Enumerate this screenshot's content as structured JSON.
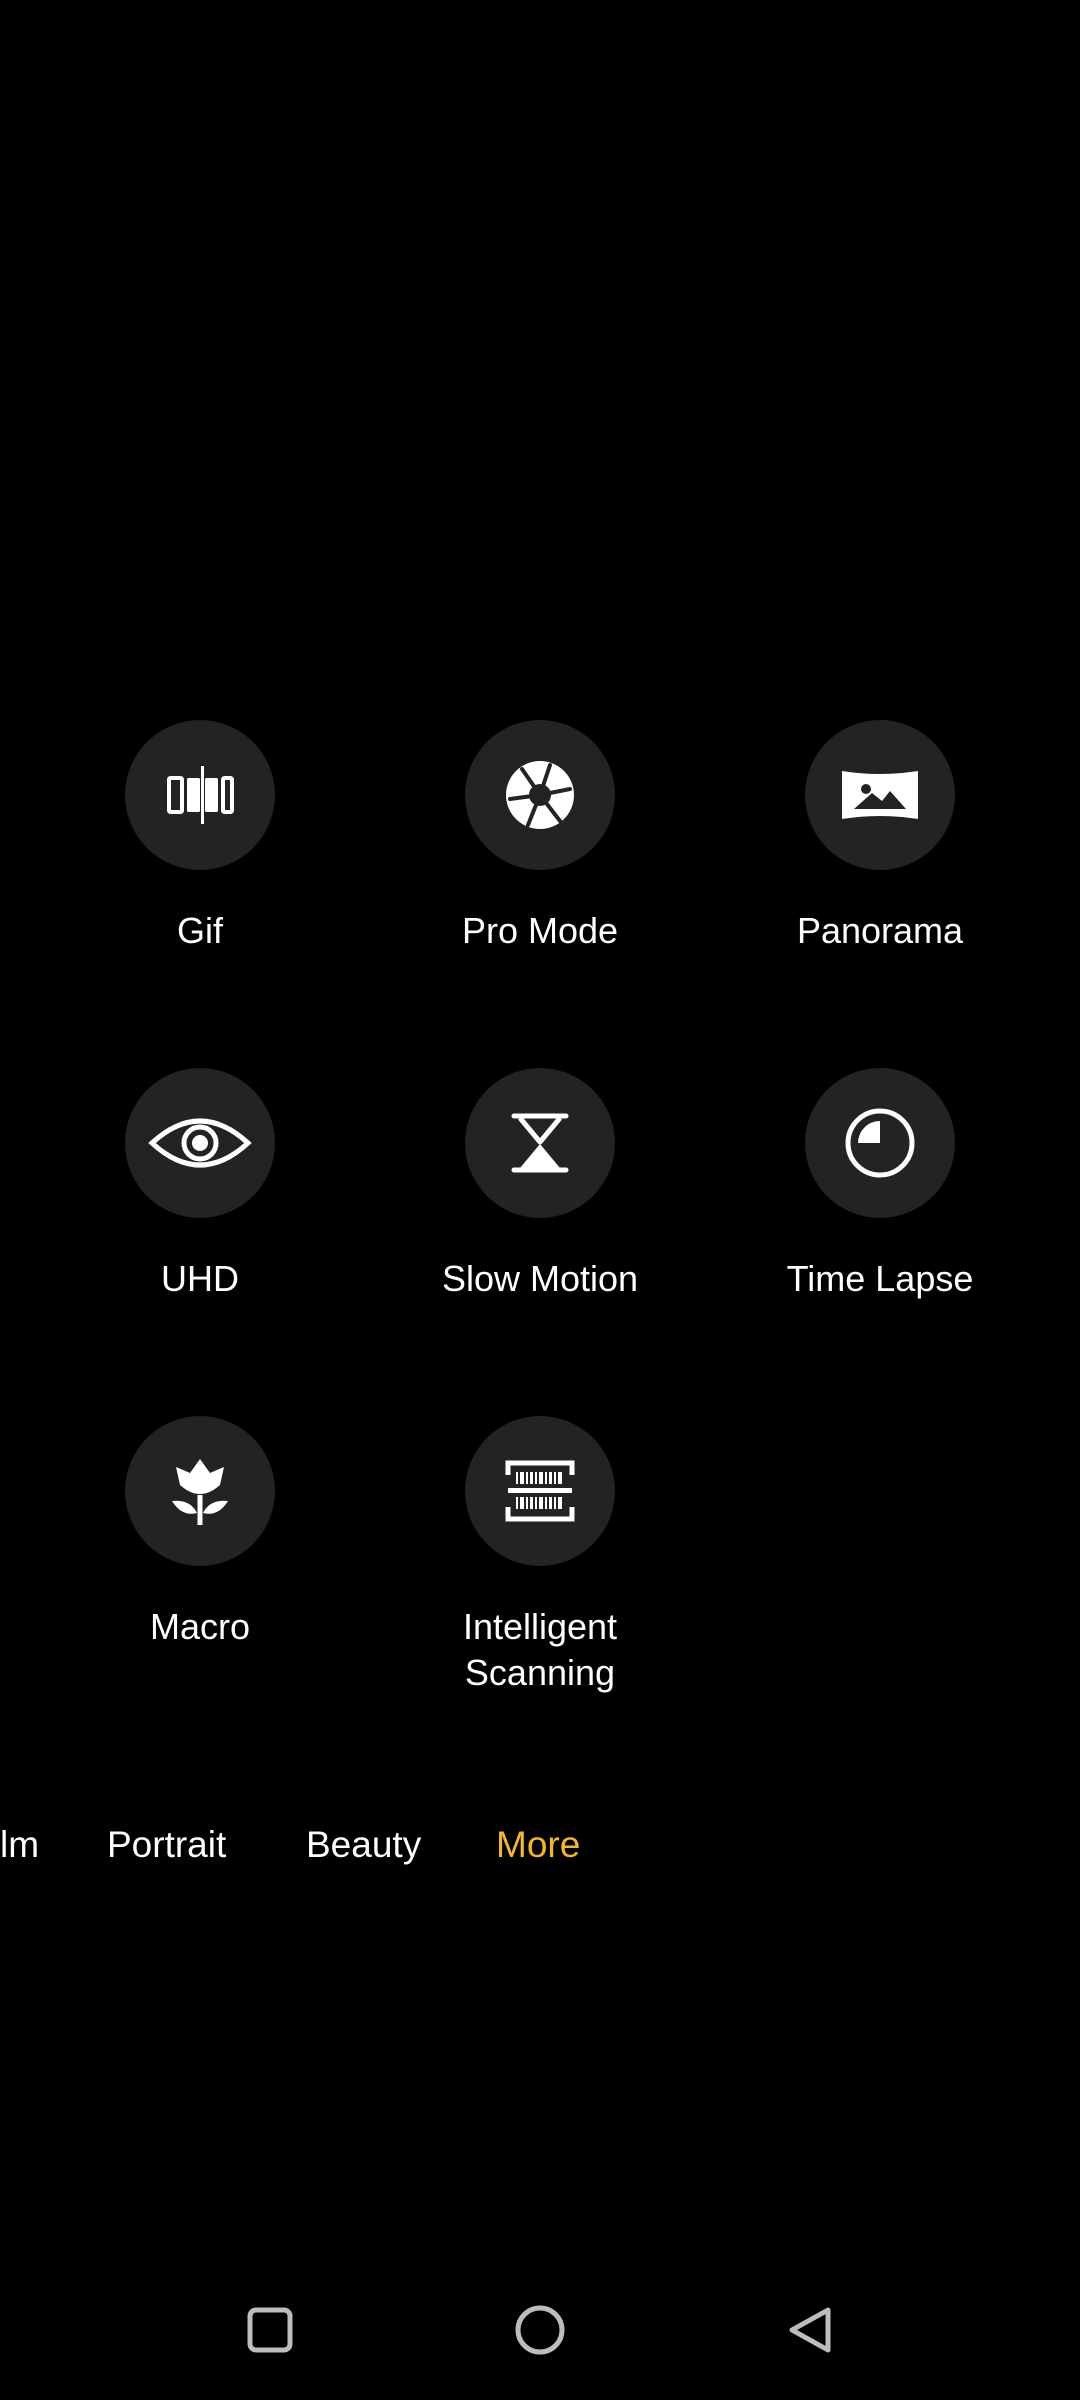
{
  "modes": [
    {
      "id": "gif",
      "label": "Gif",
      "icon": "gif-frames-icon"
    },
    {
      "id": "pro-mode",
      "label": "Pro Mode",
      "icon": "aperture-icon"
    },
    {
      "id": "panorama",
      "label": "Panorama",
      "icon": "landscape-icon"
    },
    {
      "id": "uhd",
      "label": "UHD",
      "icon": "eye-icon"
    },
    {
      "id": "slow-motion",
      "label": "Slow Motion",
      "icon": "hourglass-icon"
    },
    {
      "id": "time-lapse",
      "label": "Time Lapse",
      "icon": "clock-quarter-icon"
    },
    {
      "id": "macro",
      "label": "Macro",
      "icon": "flower-icon"
    },
    {
      "id": "intelligent-scanning",
      "label": "Intelligent\nScanning",
      "icon": "barcode-scan-icon"
    }
  ],
  "mode_tabs": [
    {
      "label": "lm"
    },
    {
      "label": "Portrait"
    },
    {
      "label": "Beauty"
    },
    {
      "label": "More",
      "active": true
    }
  ],
  "colors": {
    "background": "#000000",
    "circle": "#232323",
    "active_tab": "#f3b824",
    "text": "#ffffff"
  },
  "nav": {
    "recents": "recents-square-icon",
    "home": "home-circle-icon",
    "back": "back-triangle-icon"
  }
}
